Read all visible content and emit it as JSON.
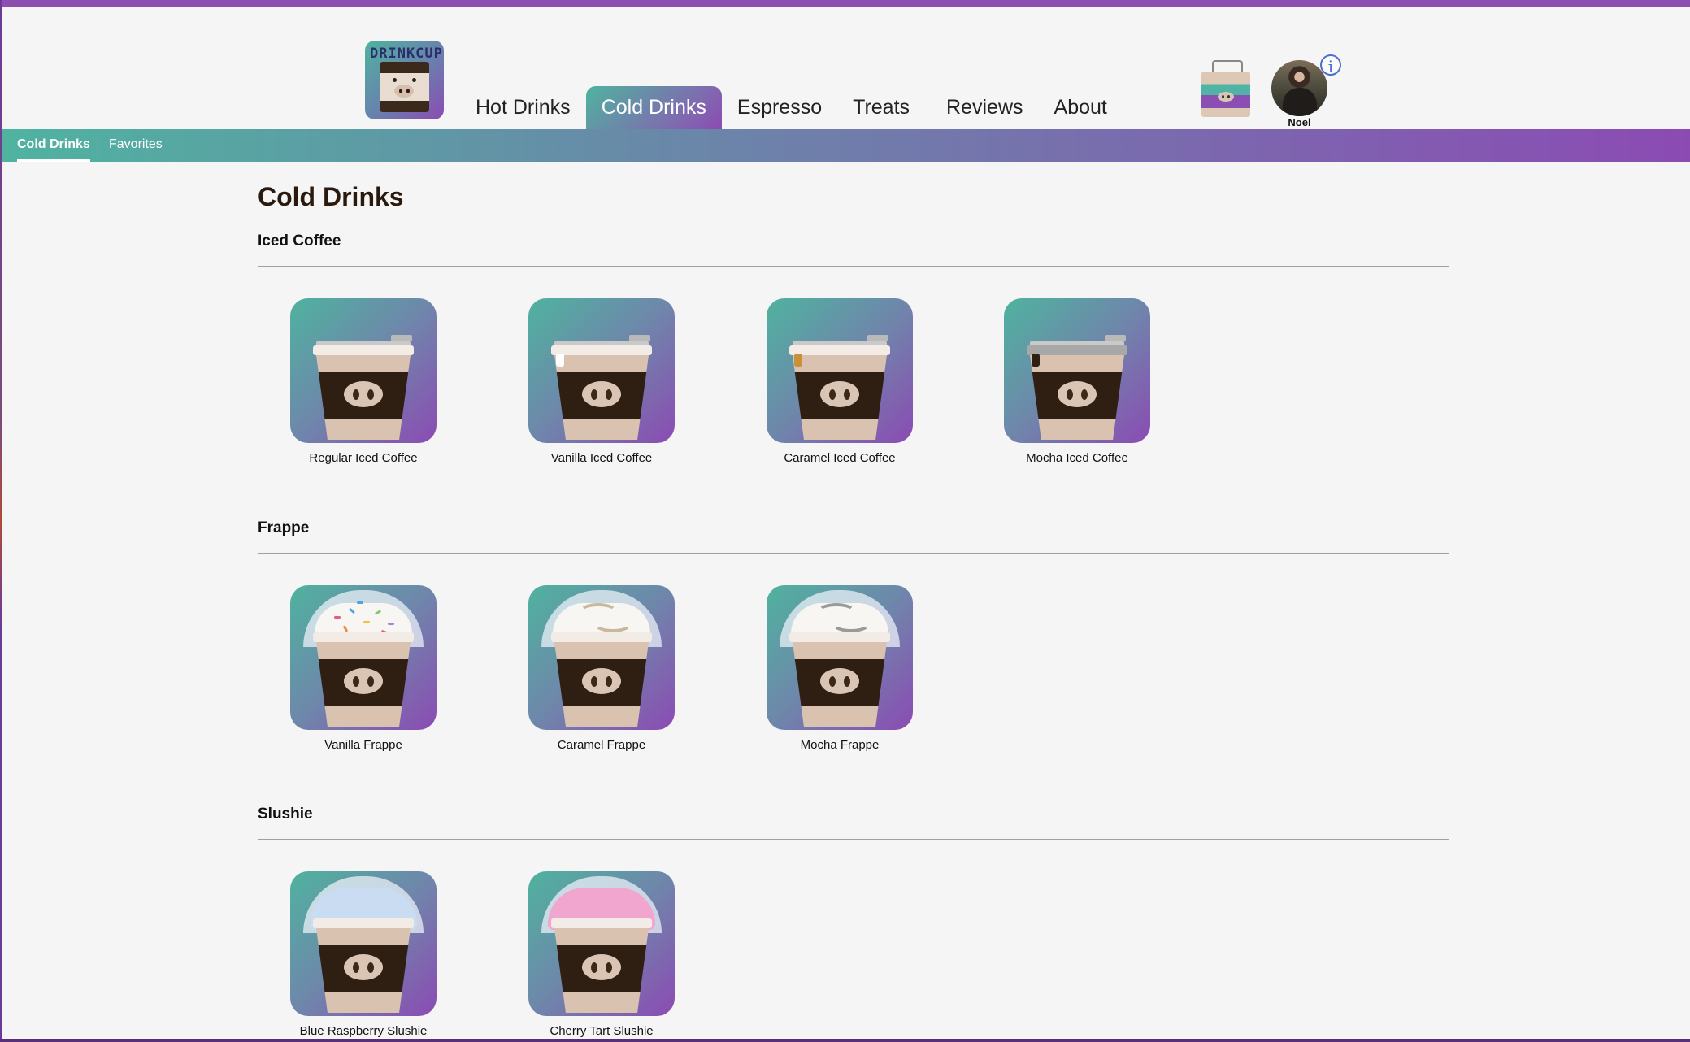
{
  "header": {
    "logo_text": "DRINKCUP",
    "nav": [
      "Hot Drinks",
      "Cold Drinks",
      "Espresso",
      "Treats",
      "Reviews",
      "About"
    ],
    "active_nav": "Cold Drinks",
    "user_name": "Noel",
    "info_glyph": "i"
  },
  "subnav": {
    "tabs": [
      "Cold Drinks",
      "Favorites"
    ],
    "active": "Cold Drinks"
  },
  "page": {
    "title": "Cold Drinks",
    "sections": [
      {
        "title": "Iced Coffee",
        "items": [
          "Regular Iced Coffee",
          "Vanilla Iced Coffee",
          "Caramel Iced Coffee",
          "Mocha Iced Coffee"
        ]
      },
      {
        "title": "Frappe",
        "items": [
          "Vanilla Frappe",
          "Caramel Frappe",
          "Mocha Frappe"
        ]
      },
      {
        "title": "Slushie",
        "items": [
          "Blue Raspberry Slushie",
          "Cherry Tart Slushie"
        ]
      }
    ]
  },
  "colors": {
    "accent_top": "#8c4fb0",
    "gradient_start": "#4fb39f",
    "gradient_end": "#8b4bb3",
    "cup_dark": "#2f1f12",
    "cup_light": "#d9c2b0",
    "caramel": "#c9913a",
    "blue_slush": "#c9dcf2",
    "cherry_slush": "#f0a6cf"
  },
  "icons": [
    "drinkcup-logo-icon",
    "shopping-bag-icon",
    "info-icon",
    "drink-cup-icon"
  ]
}
